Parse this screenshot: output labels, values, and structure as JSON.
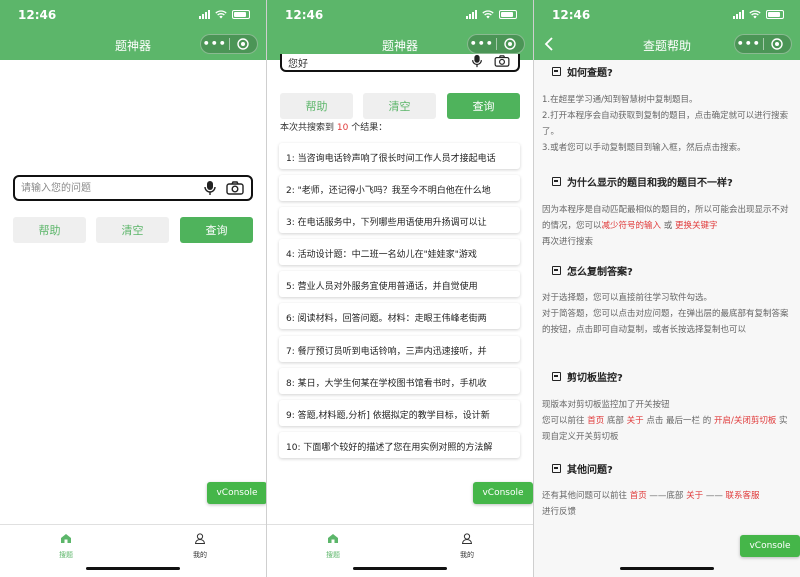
{
  "status": {
    "time": "12:46"
  },
  "screen1": {
    "nav_title": "题神器",
    "faded_text": "    ",
    "search_placeholder": "请输入您的问题",
    "buttons": {
      "help": "帮助",
      "clear": "清空",
      "query": "查询"
    }
  },
  "screen2": {
    "nav_title": "题神器",
    "query_value": "您好",
    "buttons": {
      "help": "帮助",
      "clear": "清空",
      "query": "查询"
    },
    "result_count": {
      "prefix": "本次共搜索到",
      "count": "10",
      "suffix": "个结果："
    },
    "results": [
      "1: 当咨询电话铃声响了很长时间工作人员才接起电话",
      "2: \"老师，还记得小飞吗？我至今不明白他在什么地",
      "3: 在电话服务中，下列哪些用语使用升扬调可以让",
      "4: 活动设计题：中二班一名幼儿在\"娃娃家\"游戏",
      "5: 营业人员对外服务宜使用普通话，并自觉使用",
      "6: 阅读材料，回答问题。材料：走眼王伟峰老街两",
      "7: 餐厅预订员听到电话铃响，三声内迅速接听，并",
      "8: 某日，大学生何某在学校图书馆看书时，手机收",
      "9: 答题,材料题,分析] 依据拟定的教学目标，设计新",
      "10: 下面哪个较好的描述了您在用实例对照的方法解"
    ]
  },
  "screen3": {
    "nav_title": "查题帮助",
    "sections": [
      {
        "title": "如何查题?",
        "lines": [
          "1.在超星学习通/知到智慧树中复制题目。",
          "2.打开本程序会自动获取到复制的题目，点击确定就可以进行搜索了。",
          "3.或者您可以手动复制题目到输入框，然后点击搜索。"
        ]
      },
      {
        "title": "为什么显示的题目和我的题目不一样?",
        "p1": "因为本程序是自动匹配最相似的题目的，所以可能会出现显示不对的情况，您可以",
        "r1": "减少符号的输入",
        "p2": " 或 ",
        "r2": "更换关键字",
        "p3": "再次进行搜索"
      },
      {
        "title": "怎么复制答案?",
        "lines": [
          "对于选择题，您可以直接前往学习软件勾选。",
          "对于简答题，您可以点击对应问题，在弹出层的最底部有复制答案的按钮，点击即可自动复制，或者长按选择复制也可以"
        ]
      },
      {
        "title": "剪切板监控?",
        "line1": "现版本对剪切板监控加了开关按钮",
        "p1": "您可以前往 ",
        "r1": "首页",
        "p2": " 底部 ",
        "r2": "关于",
        "p3": " 点击 最后一栏 的 ",
        "r3": "开启/关闭剪切板",
        "p4": " 实现自定义开关剪切板"
      },
      {
        "title": "其他问题?",
        "p1": "还有其他问题可以前往 ",
        "r1": "首页",
        "p2": " ——底部 ",
        "r2": "关于",
        "p3": " —— ",
        "r3": "联系客服",
        "p4": "进行反馈"
      }
    ]
  },
  "tabbar": {
    "home": "搜题",
    "mine": "我的"
  },
  "vconsole_label": "vConsole",
  "colors": {
    "brand_green": "#5cb66a",
    "button_green": "#4fb35c",
    "highlight_red": "#e03a3a"
  }
}
